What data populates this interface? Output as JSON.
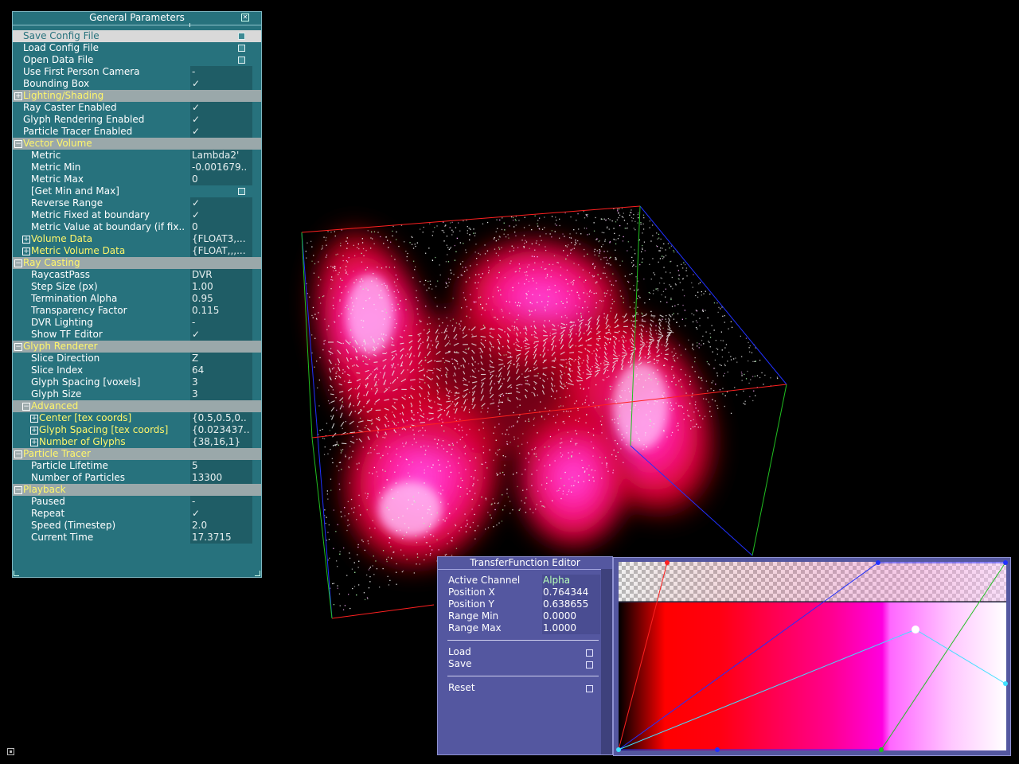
{
  "general": {
    "title": "General Parameters",
    "save_config": "Save Config File",
    "load_config": "Load Config File",
    "open_data": "Open Data File",
    "first_person": "Use First Person Camera",
    "first_person_val": "-",
    "bounding_box": "Bounding Box",
    "lighting": "Lighting/Shading",
    "ray_caster": "Ray Caster Enabled",
    "glyph_rendering": "Glyph Rendering Enabled",
    "particle_tracer_enabled": "Particle Tracer Enabled",
    "vector_volume": {
      "label": "Vector Volume",
      "metric": "Metric",
      "metric_val": "Lambda2'",
      "metric_min": "Metric Min",
      "metric_min_val": "-0.001679..",
      "metric_max": "Metric Max",
      "metric_max_val": "0",
      "get_min_max": "[Get Min and Max]",
      "reverse_range": "Reverse Range",
      "metric_fixed": "Metric Fixed at boundary",
      "metric_value_boundary": "Metric Value at boundary (if fix..",
      "metric_value_boundary_val": "0",
      "volume_data": "Volume Data",
      "volume_data_val": "{FLOAT3,...",
      "metric_volume_data": "Metric Volume Data",
      "metric_volume_data_val": "{FLOAT,,,..."
    },
    "ray_casting": {
      "label": "Ray Casting",
      "raycast_pass": "RaycastPass",
      "raycast_pass_val": "DVR",
      "step_size": "Step Size (px)",
      "step_size_val": "1.00",
      "termination_alpha": "Termination Alpha",
      "termination_alpha_val": "0.95",
      "transparency": "Transparency Factor",
      "transparency_val": "0.115",
      "dvr_lighting": "DVR Lighting",
      "dvr_lighting_val": "-",
      "show_tf": "Show TF Editor"
    },
    "glyph_renderer": {
      "label": "Glyph Renderer",
      "slice_direction": "Slice Direction",
      "slice_direction_val": "Z",
      "slice_index": "Slice Index",
      "slice_index_val": "64",
      "glyph_spacing_vox": "Glyph Spacing [voxels]",
      "glyph_spacing_vox_val": "3",
      "glyph_size": "Glyph Size",
      "glyph_size_val": "3",
      "advanced": "Advanced",
      "center": "Center [tex coords]",
      "center_val": "{0.5,0.5,0..",
      "glyph_spacing_tex": "Glyph Spacing [tex coords]",
      "glyph_spacing_tex_val": "{0.023437..",
      "num_glyphs": "Number of Glyphs",
      "num_glyphs_val": "{38,16,1}"
    },
    "particle_tracer": {
      "label": "Particle Tracer",
      "lifetime": "Particle Lifetime",
      "lifetime_val": "5",
      "num_particles": "Number of Particles",
      "num_particles_val": "13300"
    },
    "playback": {
      "label": "Playback",
      "paused": "Paused",
      "paused_val": "-",
      "repeat": "Repeat",
      "speed": "Speed (Timestep)",
      "speed_val": "2.0",
      "current_time": "Current Time",
      "current_time_val": "17.3715"
    },
    "check": "✓"
  },
  "tf_editor": {
    "title": "TransferFunction Editor",
    "active_channel": "Active Channel",
    "active_channel_val": "Alpha",
    "position_x": "Position X",
    "position_x_val": "0.764344",
    "position_y": "Position Y",
    "position_y_val": "0.638655",
    "range_min": "Range Min",
    "range_min_val": "0.0000",
    "range_max": "Range Max",
    "range_max_val": "1.0000",
    "load": "Load",
    "save": "Save",
    "reset": "Reset"
  },
  "colors": {
    "panel_bg": "#27727d",
    "tf_bg": "#5457a0",
    "group_label": "#fff66b"
  }
}
